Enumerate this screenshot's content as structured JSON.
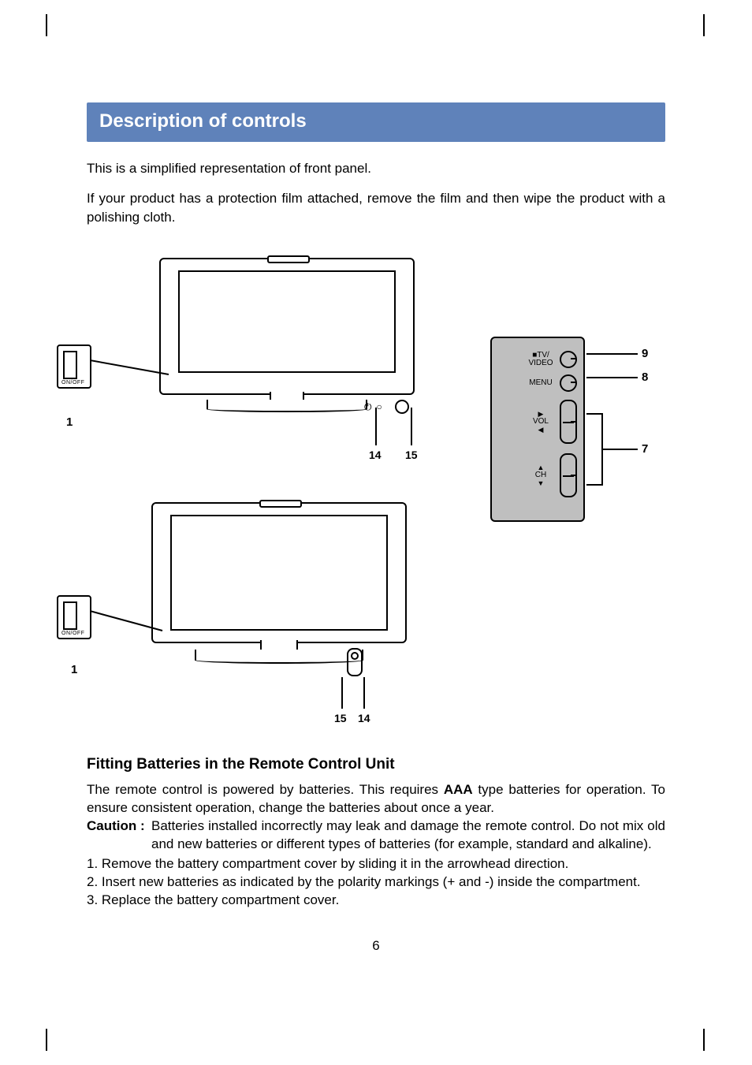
{
  "section_title": "Description of controls",
  "intro": {
    "p1": "This is a simplified representation of front panel.",
    "p2": "If your product has a protection film attached, remove the film and then wipe the product with a polishing cloth."
  },
  "diagram": {
    "power_label": "ON/OFF",
    "side_panel": {
      "tv_video_1": "■TV/",
      "tv_video_2": "VIDEO",
      "menu": "MENU",
      "vol": "VOL",
      "ch": "CH",
      "arrow_right": "▶",
      "arrow_left": "◀",
      "arrow_up": "▲",
      "arrow_down": "▼"
    },
    "callouts": {
      "n1": "1",
      "n7": "7",
      "n8": "8",
      "n9": "9",
      "n14": "14",
      "n15": "15"
    }
  },
  "batteries": {
    "heading": "Fitting Batteries in the Remote Control Unit",
    "para_pre": "The remote control is powered by batteries. This requires ",
    "aaa": "AAA",
    "para_post": " type batteries for operation. To ensure consistent operation, change the batteries about once a year.",
    "caution_label": "Caution :",
    "caution_text": "Batteries installed incorrectly may leak and damage the remote control. Do not mix old and new batteries or different types of batteries (for example, standard and alkaline).",
    "step1": "1. Remove the battery compartment cover by sliding it in the arrowhead direction.",
    "step2_pre": "2. Insert new batteries as indicated by the polarity markings (",
    "step2_plus": "+",
    "step2_mid": " and ",
    "step2_minus": "-",
    "step2_post": ") inside the compartment.",
    "step3": "3. Replace the battery compartment cover."
  },
  "page_number": "6"
}
